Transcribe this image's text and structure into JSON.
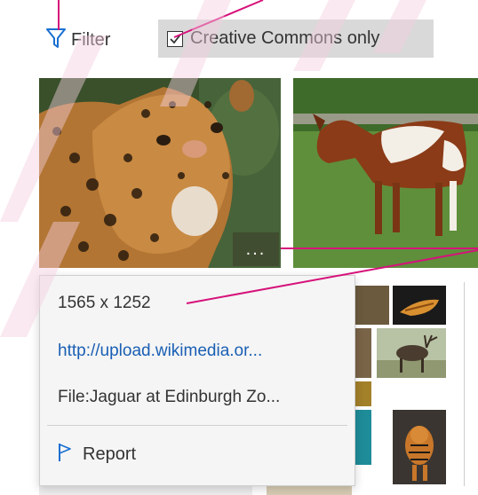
{
  "toolbar": {
    "filter_label": "Filter",
    "cc_label": "Creative Commons only",
    "cc_checked": true
  },
  "thumbnails": [
    {
      "subject": "jaguar"
    },
    {
      "subject": "pinto-horse"
    }
  ],
  "more_button_label": "...",
  "context_menu": {
    "dimensions": "1565 x 1252",
    "url": "http://upload.wikimedia.or...",
    "filename": "File:Jaguar at Edinburgh Zo...",
    "report_label": "Report"
  },
  "colors": {
    "accent_blue": "#1a6fd1",
    "callout_magenta": "#d6127a",
    "link_blue": "#1a5fb4",
    "menu_bg": "#f5f5f5",
    "watermark": "#f4cfdf"
  }
}
